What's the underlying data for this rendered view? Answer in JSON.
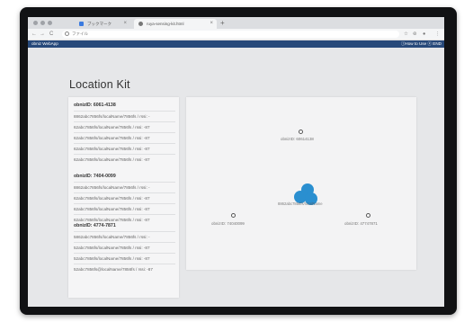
{
  "browser": {
    "tabs": [
      {
        "label": "ブックマーク"
      },
      {
        "label": "ruya-sensing-kit.html"
      }
    ],
    "new_tab": "+",
    "nav": {
      "back": "←",
      "forward": "→",
      "reload": "C"
    },
    "address": "ファイル"
  },
  "appbar": {
    "brand": "obniz WebApp",
    "links": "ⓘHow to Use ⓧ END"
  },
  "page": {
    "title": "Location Kit"
  },
  "groups": [
    {
      "title": "obnizID: 6061-4138",
      "rows": [
        "8862abc7856fs/localName/7856fs / rssi: -",
        "62abc7856fs/localName/7856fs / rssi: -87",
        "62abc7856fs/localName/7856fs / rssi: -87",
        "62abc7856fs/localName/7856fs / rssi: -87",
        "62abc7856fs/localName/7856fs / rssi: -87"
      ]
    },
    {
      "title": "obnizID: 7404-0099",
      "rows": [
        "8862abc7856fs/localName/7856fs / rssi: -",
        "62abc7856fs/localName/7856fs / rssi: -87",
        "62abc7856fs/localName/7856fs / rssi: -87",
        "62abc7856fs/localName/7856fs / rssi: -87"
      ]
    },
    {
      "title": "obnizID: 4774-7871",
      "rows": [
        "5862abc7856fs/localName/7856fs / rssi: -",
        "52abc7856fs/localName/7856fs / rssi: -87",
        "52abc7856fs/localName/7856fs / rssi: -87",
        "52abc7856fs@localName/7856fs / rssi: -87"
      ]
    }
  ],
  "map": {
    "beacons": [
      {
        "label": "obnizID: 60614138"
      },
      {
        "label": "obnizID: 74040099"
      },
      {
        "label": "obnizID: 47747871"
      }
    ],
    "tag_label": "8862abc7856fs/localName"
  },
  "colors": {
    "appbar": "#27497a",
    "tag": "#2a8fd0"
  },
  "icons": [
    "star-icon",
    "globe-icon",
    "close-icon",
    "info-icon",
    "bookmark-star-icon",
    "extension-icon",
    "account-icon",
    "menu-icon",
    "cloud-tag-icon"
  ]
}
